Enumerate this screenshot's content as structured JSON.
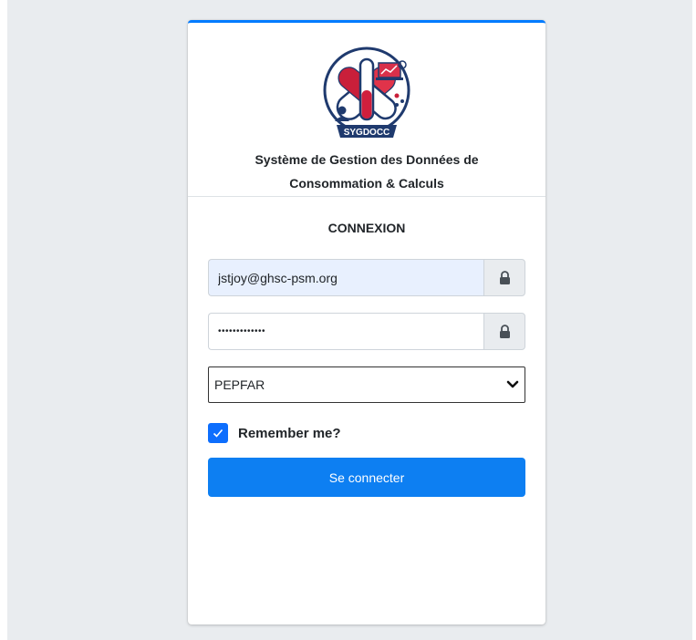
{
  "brand": {
    "logo_text": "SYGDOCC",
    "app_name_line1": "Système de Gestion des Données de",
    "app_name_line2": "Consommation & Calculs"
  },
  "login": {
    "title": "CONNEXION",
    "email_value": "jstjoy@ghsc-psm.org",
    "password_value": "•••••••••••••",
    "email_icon": "lock-icon",
    "password_icon": "lock-icon",
    "program_selected": "PEPFAR",
    "remember_label": "Remember me?",
    "remember_checked": true,
    "submit_label": "Se connecter"
  },
  "colors": {
    "accent": "#007bff",
    "button": "#0d7ff2",
    "autofill": "#e8f0fe"
  }
}
